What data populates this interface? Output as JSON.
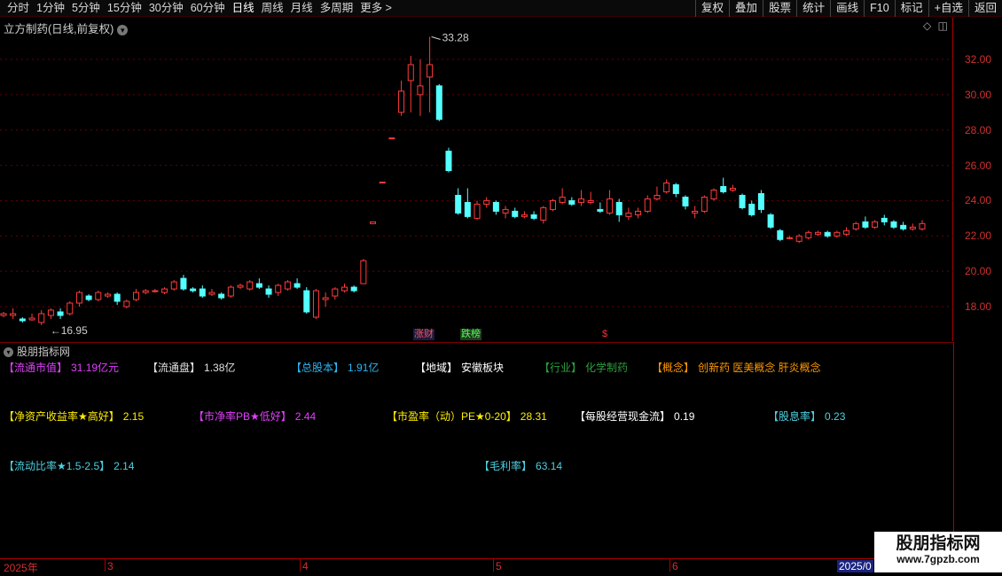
{
  "toolbar": {
    "periods": [
      {
        "label": "分时",
        "active": false
      },
      {
        "label": "1分钟",
        "active": false
      },
      {
        "label": "5分钟",
        "active": false
      },
      {
        "label": "15分钟",
        "active": false
      },
      {
        "label": "30分钟",
        "active": false
      },
      {
        "label": "60分钟",
        "active": false
      },
      {
        "label": "日线",
        "active": true
      },
      {
        "label": "周线",
        "active": false
      },
      {
        "label": "月线",
        "active": false
      },
      {
        "label": "多周期",
        "active": false
      }
    ],
    "more": "更多 >",
    "right_buttons": [
      "复权",
      "叠加",
      "股票",
      "统计",
      "画线",
      "F10",
      "标记",
      "+自选",
      "返回"
    ]
  },
  "chart": {
    "title": "立方制药(日线,前复权)",
    "high_label": "33.28",
    "low_label": "16.95",
    "badges": {
      "zhangcai": "涨财",
      "diebang": "跌榜",
      "dollar": "$"
    }
  },
  "panel": {
    "title": "股朋指标网",
    "items": [
      {
        "label": "【流通市值】",
        "value": "31.19亿元",
        "color": "#e040fb"
      },
      {
        "label": "【流通盘】",
        "value": "1.38亿",
        "color": "#e0e0e0"
      },
      {
        "label": "【总股本】",
        "value": "1.91亿",
        "color": "#29b6f6"
      },
      {
        "label": "【地域】",
        "value": "安徽板块",
        "color": "#ffffff"
      },
      {
        "label": "【行业】",
        "value": "化学制药",
        "color": "#2e9e3e"
      },
      {
        "label": "【概念】",
        "value": "创新药 医美概念 肝炎概念",
        "color": "#ff9800"
      },
      {
        "label": "【净资产收益率★高好】",
        "value": "2.15",
        "color": "#ffee00"
      },
      {
        "label": "【市净率PB★低好】",
        "value": "2.44",
        "color": "#e040fb"
      },
      {
        "label": "【市盈率（动）PE★0-20】",
        "value": "28.31",
        "color": "#ffee00"
      },
      {
        "label": "【每股经营现金流】",
        "value": "0.19",
        "color": "#ffffff"
      },
      {
        "label": "【股息率】",
        "value": "0.23",
        "color": "#4dd0e1"
      },
      {
        "label": "【流动比率★1.5-2.5】",
        "value": "2.14",
        "color": "#4dd0e1"
      },
      {
        "label": "【毛利率】",
        "value": "63.14",
        "color": "#4dd0e1"
      }
    ]
  },
  "date_axis": {
    "ticks": [
      "2025年",
      "3",
      "4",
      "5",
      "6"
    ],
    "cursor": "2025/0"
  },
  "watermark": {
    "name": "股朋指标网",
    "url": "www.7gpzb.com"
  },
  "colors": {
    "up": "#ff3c3c",
    "down": "#54ffff",
    "grid": "#6a0000",
    "axis": "#d03030",
    "bg": "#000000"
  },
  "chart_data": {
    "type": "candlestick",
    "title": "立方制药(日线,前复权)",
    "y_ticks": [
      18,
      20,
      22,
      24,
      26,
      28,
      30,
      32
    ],
    "ylim": [
      16.2,
      33.6
    ],
    "candles": [
      {
        "o": 17.5,
        "c": 17.6,
        "h": 17.7,
        "l": 17.4
      },
      {
        "o": 17.5,
        "c": 17.6,
        "h": 17.9,
        "l": 17.3
      },
      {
        "o": 17.3,
        "c": 17.2,
        "h": 17.4,
        "l": 17.1
      },
      {
        "o": 17.25,
        "c": 17.35,
        "h": 17.6,
        "l": 17.2
      },
      {
        "o": 17.1,
        "c": 17.6,
        "h": 17.8,
        "l": 16.95
      },
      {
        "o": 17.5,
        "c": 17.8,
        "h": 17.9,
        "l": 17.3
      },
      {
        "o": 17.7,
        "c": 17.5,
        "h": 17.9,
        "l": 17.3
      },
      {
        "o": 17.6,
        "c": 18.2,
        "h": 18.3,
        "l": 17.5
      },
      {
        "o": 18.2,
        "c": 18.8,
        "h": 18.9,
        "l": 18.0
      },
      {
        "o": 18.6,
        "c": 18.4,
        "h": 18.7,
        "l": 18.3
      },
      {
        "o": 18.4,
        "c": 18.8,
        "h": 18.9,
        "l": 18.3
      },
      {
        "o": 18.6,
        "c": 18.7,
        "h": 18.8,
        "l": 18.5
      },
      {
        "o": 18.7,
        "c": 18.3,
        "h": 18.8,
        "l": 18.1
      },
      {
        "o": 18.0,
        "c": 18.3,
        "h": 18.4,
        "l": 17.9
      },
      {
        "o": 18.4,
        "c": 18.8,
        "h": 19.0,
        "l": 18.3
      },
      {
        "o": 18.8,
        "c": 18.9,
        "h": 19.0,
        "l": 18.7
      },
      {
        "o": 18.9,
        "c": 18.9,
        "h": 19.0,
        "l": 18.8
      },
      {
        "o": 18.8,
        "c": 19.0,
        "h": 19.1,
        "l": 18.7
      },
      {
        "o": 19.0,
        "c": 19.4,
        "h": 19.5,
        "l": 18.9
      },
      {
        "o": 19.6,
        "c": 19.0,
        "h": 19.8,
        "l": 18.9
      },
      {
        "o": 19.0,
        "c": 18.9,
        "h": 19.1,
        "l": 18.8
      },
      {
        "o": 19.0,
        "c": 18.6,
        "h": 19.2,
        "l": 18.5
      },
      {
        "o": 18.7,
        "c": 18.8,
        "h": 19.0,
        "l": 18.6
      },
      {
        "o": 18.7,
        "c": 18.5,
        "h": 18.8,
        "l": 18.4
      },
      {
        "o": 18.6,
        "c": 19.1,
        "h": 19.2,
        "l": 18.5
      },
      {
        "o": 19.1,
        "c": 19.2,
        "h": 19.3,
        "l": 19.0
      },
      {
        "o": 19.0,
        "c": 19.4,
        "h": 19.5,
        "l": 18.9
      },
      {
        "o": 19.3,
        "c": 19.1,
        "h": 19.6,
        "l": 19.0
      },
      {
        "o": 19.0,
        "c": 18.7,
        "h": 19.2,
        "l": 18.5
      },
      {
        "o": 18.8,
        "c": 19.2,
        "h": 19.3,
        "l": 18.6
      },
      {
        "o": 19.0,
        "c": 19.4,
        "h": 19.5,
        "l": 18.9
      },
      {
        "o": 19.3,
        "c": 19.1,
        "h": 19.6,
        "l": 19.0
      },
      {
        "o": 18.9,
        "c": 17.7,
        "h": 19.1,
        "l": 17.6
      },
      {
        "o": 17.4,
        "c": 18.9,
        "h": 19.0,
        "l": 17.3
      },
      {
        "o": 18.4,
        "c": 18.5,
        "h": 18.8,
        "l": 18.0
      },
      {
        "o": 18.6,
        "c": 19.0,
        "h": 19.1,
        "l": 18.4
      },
      {
        "o": 18.9,
        "c": 19.1,
        "h": 19.3,
        "l": 18.8
      },
      {
        "o": 19.1,
        "c": 18.9,
        "h": 19.2,
        "l": 18.8
      },
      {
        "o": 19.3,
        "c": 20.6,
        "h": 20.7,
        "l": 19.3
      },
      {
        "o": 22.7,
        "c": 22.8,
        "h": 22.8,
        "l": 22.7
      },
      {
        "o": 25.0,
        "c": 25.05,
        "h": 25.05,
        "l": 25.0
      },
      {
        "o": 27.5,
        "c": 27.55,
        "h": 27.55,
        "l": 27.5
      },
      {
        "o": 29.0,
        "c": 30.2,
        "h": 30.8,
        "l": 28.8
      },
      {
        "o": 30.8,
        "c": 31.7,
        "h": 32.2,
        "l": 29.0
      },
      {
        "o": 30.0,
        "c": 30.5,
        "h": 32.0,
        "l": 28.8
      },
      {
        "o": 31.0,
        "c": 31.7,
        "h": 33.28,
        "l": 29.0
      },
      {
        "o": 30.5,
        "c": 28.6,
        "h": 30.6,
        "l": 28.5
      },
      {
        "o": 26.8,
        "c": 25.7,
        "h": 27.0,
        "l": 25.6
      },
      {
        "o": 24.3,
        "c": 23.3,
        "h": 24.7,
        "l": 23.2
      },
      {
        "o": 23.9,
        "c": 23.1,
        "h": 24.7,
        "l": 23.0
      },
      {
        "o": 23.0,
        "c": 23.8,
        "h": 24.0,
        "l": 22.9
      },
      {
        "o": 23.8,
        "c": 24.0,
        "h": 24.2,
        "l": 23.6
      },
      {
        "o": 23.9,
        "c": 23.4,
        "h": 24.0,
        "l": 23.2
      },
      {
        "o": 23.3,
        "c": 23.5,
        "h": 23.7,
        "l": 23.0
      },
      {
        "o": 23.4,
        "c": 23.1,
        "h": 23.6,
        "l": 23.0
      },
      {
        "o": 23.1,
        "c": 23.2,
        "h": 23.4,
        "l": 23.0
      },
      {
        "o": 23.2,
        "c": 23.0,
        "h": 23.4,
        "l": 22.9
      },
      {
        "o": 22.9,
        "c": 23.6,
        "h": 23.7,
        "l": 22.7
      },
      {
        "o": 23.5,
        "c": 24.0,
        "h": 24.1,
        "l": 23.4
      },
      {
        "o": 23.9,
        "c": 24.2,
        "h": 24.7,
        "l": 23.8
      },
      {
        "o": 24.0,
        "c": 23.8,
        "h": 24.2,
        "l": 23.7
      },
      {
        "o": 23.9,
        "c": 24.1,
        "h": 24.6,
        "l": 23.7
      },
      {
        "o": 23.9,
        "c": 24.0,
        "h": 24.5,
        "l": 23.8
      },
      {
        "o": 23.5,
        "c": 23.4,
        "h": 23.9,
        "l": 23.3
      },
      {
        "o": 23.3,
        "c": 24.1,
        "h": 24.6,
        "l": 23.2
      },
      {
        "o": 23.9,
        "c": 23.2,
        "h": 24.1,
        "l": 22.8
      },
      {
        "o": 23.1,
        "c": 23.3,
        "h": 23.6,
        "l": 22.9
      },
      {
        "o": 23.2,
        "c": 23.4,
        "h": 23.6,
        "l": 23.0
      },
      {
        "o": 23.4,
        "c": 24.1,
        "h": 24.3,
        "l": 23.3
      },
      {
        "o": 24.1,
        "c": 24.3,
        "h": 24.8,
        "l": 24.0
      },
      {
        "o": 24.5,
        "c": 25.0,
        "h": 25.2,
        "l": 24.4
      },
      {
        "o": 24.9,
        "c": 24.4,
        "h": 25.0,
        "l": 24.2
      },
      {
        "o": 24.2,
        "c": 23.7,
        "h": 24.3,
        "l": 23.5
      },
      {
        "o": 23.3,
        "c": 23.4,
        "h": 23.7,
        "l": 23.0
      },
      {
        "o": 23.4,
        "c": 24.2,
        "h": 24.3,
        "l": 23.3
      },
      {
        "o": 24.1,
        "c": 24.6,
        "h": 24.7,
        "l": 24.0
      },
      {
        "o": 24.8,
        "c": 24.5,
        "h": 25.3,
        "l": 24.4
      },
      {
        "o": 24.6,
        "c": 24.7,
        "h": 24.9,
        "l": 24.5
      },
      {
        "o": 24.3,
        "c": 23.6,
        "h": 24.4,
        "l": 23.5
      },
      {
        "o": 23.8,
        "c": 23.2,
        "h": 24.0,
        "l": 23.1
      },
      {
        "o": 24.4,
        "c": 23.5,
        "h": 24.6,
        "l": 23.3
      },
      {
        "o": 23.2,
        "c": 22.5,
        "h": 23.3,
        "l": 22.4
      },
      {
        "o": 22.3,
        "c": 21.8,
        "h": 22.4,
        "l": 21.7
      },
      {
        "o": 21.9,
        "c": 21.9,
        "h": 22.0,
        "l": 21.8
      },
      {
        "o": 21.7,
        "c": 22.0,
        "h": 22.1,
        "l": 21.6
      },
      {
        "o": 21.9,
        "c": 22.2,
        "h": 22.3,
        "l": 21.8
      },
      {
        "o": 22.1,
        "c": 22.2,
        "h": 22.3,
        "l": 22.0
      },
      {
        "o": 22.2,
        "c": 22.0,
        "h": 22.3,
        "l": 21.9
      },
      {
        "o": 22.0,
        "c": 22.2,
        "h": 22.3,
        "l": 21.9
      },
      {
        "o": 22.1,
        "c": 22.3,
        "h": 22.5,
        "l": 22.0
      },
      {
        "o": 22.4,
        "c": 22.7,
        "h": 22.8,
        "l": 22.3
      },
      {
        "o": 22.8,
        "c": 22.5,
        "h": 23.1,
        "l": 22.4
      },
      {
        "o": 22.5,
        "c": 22.8,
        "h": 22.9,
        "l": 22.4
      },
      {
        "o": 23.0,
        "c": 22.8,
        "h": 23.2,
        "l": 22.6
      },
      {
        "o": 22.8,
        "c": 22.5,
        "h": 22.9,
        "l": 22.4
      },
      {
        "o": 22.6,
        "c": 22.4,
        "h": 22.8,
        "l": 22.3
      },
      {
        "o": 22.4,
        "c": 22.5,
        "h": 22.7,
        "l": 22.3
      },
      {
        "o": 22.4,
        "c": 22.7,
        "h": 22.9,
        "l": 22.3
      }
    ]
  }
}
